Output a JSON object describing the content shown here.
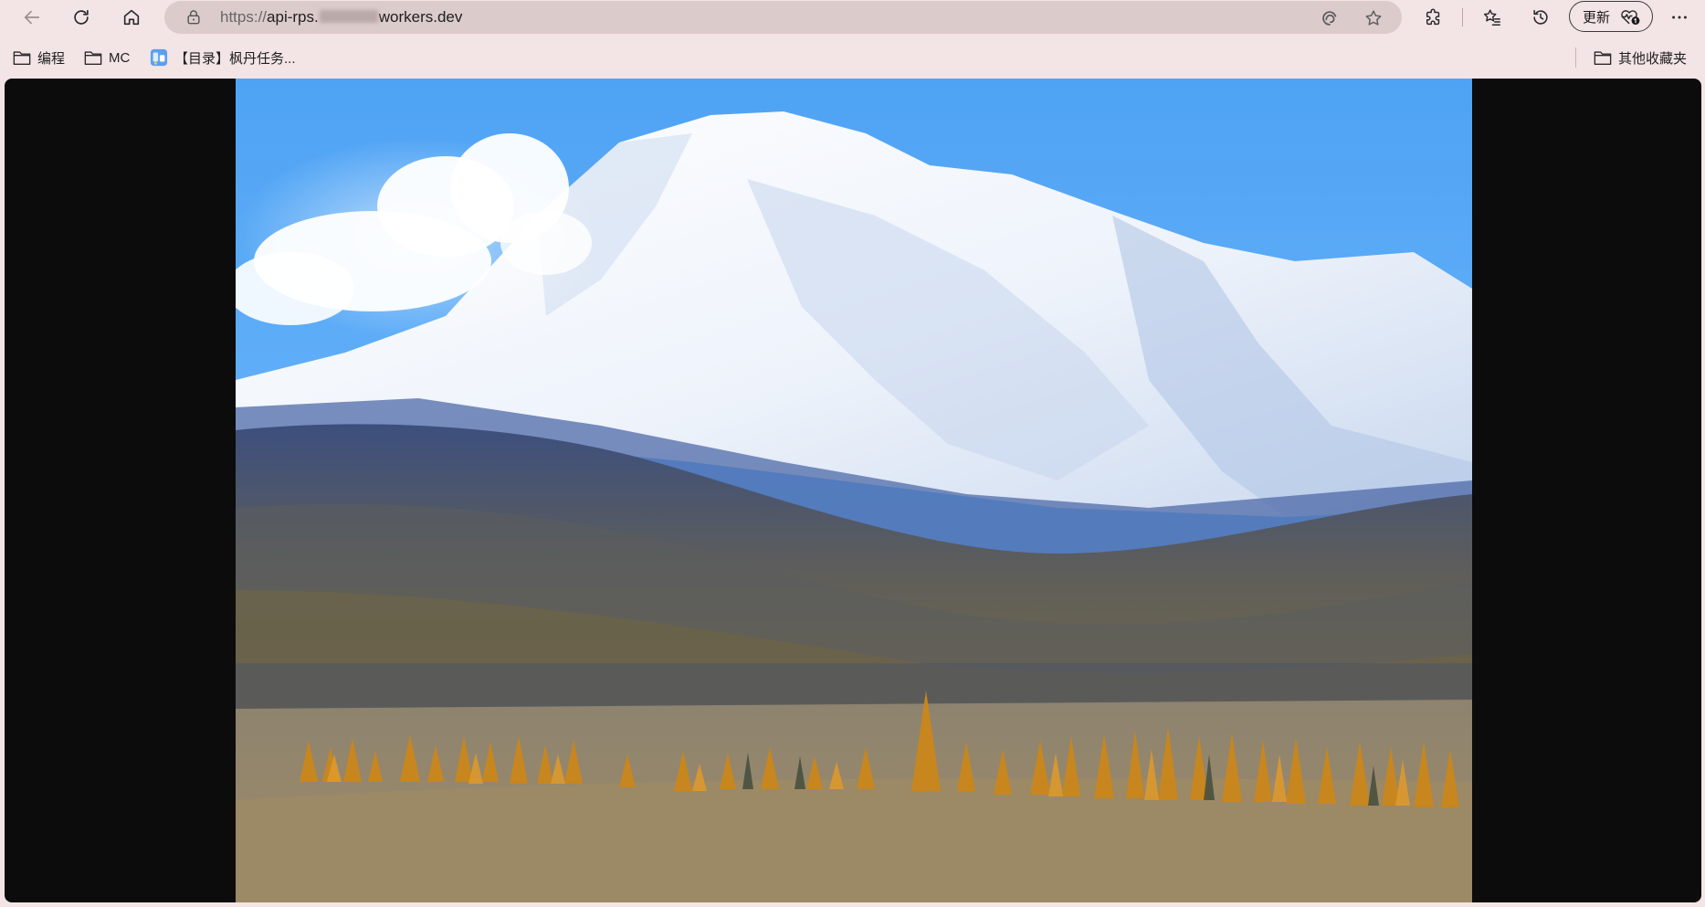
{
  "window": {
    "url_prefix": "https://",
    "url_host_start": "api-rps.",
    "url_host_end": "workers.dev",
    "update_label": "更新"
  },
  "bookmarks": {
    "items": [
      {
        "label": "编程",
        "icon": "folder-icon"
      },
      {
        "label": "MC",
        "icon": "folder-icon"
      },
      {
        "label": "【目录】枫丹任务...",
        "icon": "site-favicon"
      }
    ],
    "other_label": "其他收藏夹"
  },
  "content": {
    "image_subject": "snowy-mountain-landscape"
  },
  "colors": {
    "frame": "#f3e5e5",
    "address_bar": "#dccbcb",
    "page_background": "#0c0c0c",
    "sky": "#5aaaf5"
  }
}
